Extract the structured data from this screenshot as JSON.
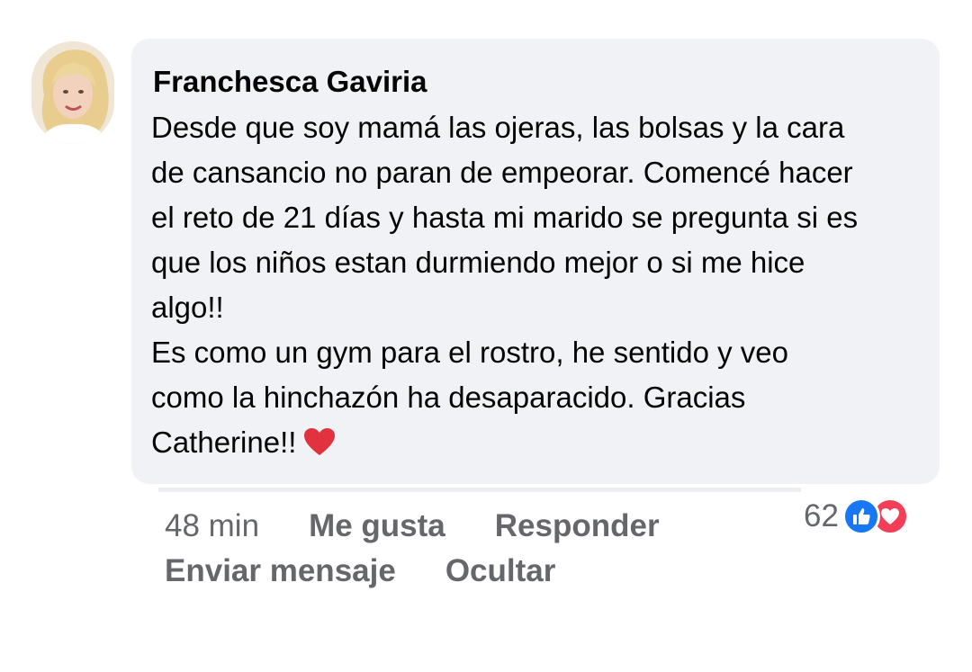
{
  "comment": {
    "author": "Franchesca Gaviria",
    "paragraph1": {
      "line1": "Desde que soy mamá las ojeras, las bolsas y la cara",
      "line2": "de cansancio no paran de empeorar. Comencé hacer",
      "line3": "el reto de 21 días y hasta mi marido se pregunta si es",
      "line4": "que los niños estan durmiendo mejor o si me hice",
      "line5": "algo!!"
    },
    "paragraph2": {
      "line1": "Es como un gym para el rostro, he sentido y veo",
      "line2": "como la hinchazón ha desaparacido. Gracias",
      "line3": "Catherine!!"
    },
    "emoji": "red-heart-icon"
  },
  "actions": {
    "time": "48 min",
    "like": "Me gusta",
    "reply": "Responder",
    "send_message": "Enviar mensaje",
    "hide": "Ocultar"
  },
  "reactions": {
    "count": "62",
    "icons": [
      "like-icon",
      "love-icon"
    ]
  },
  "colors": {
    "bubble": "#f0f2f5",
    "text": "#050505",
    "secondary_text": "#65676b",
    "like_blue": "#1877f2",
    "love_red": "#f33e58",
    "heart_emoji": "#e0323f"
  }
}
